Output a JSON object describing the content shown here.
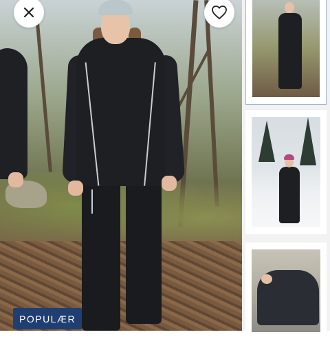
{
  "viewer": {
    "close_icon": "close-icon",
    "favorite_icon": "heart-icon",
    "badge_text": "POPULÆR",
    "badge_color": "#1f3f73"
  },
  "thumbnails": [
    {
      "scene": "forest",
      "selected": true
    },
    {
      "scene": "snow",
      "selected": false
    },
    {
      "scene": "closeup",
      "selected": false
    }
  ]
}
